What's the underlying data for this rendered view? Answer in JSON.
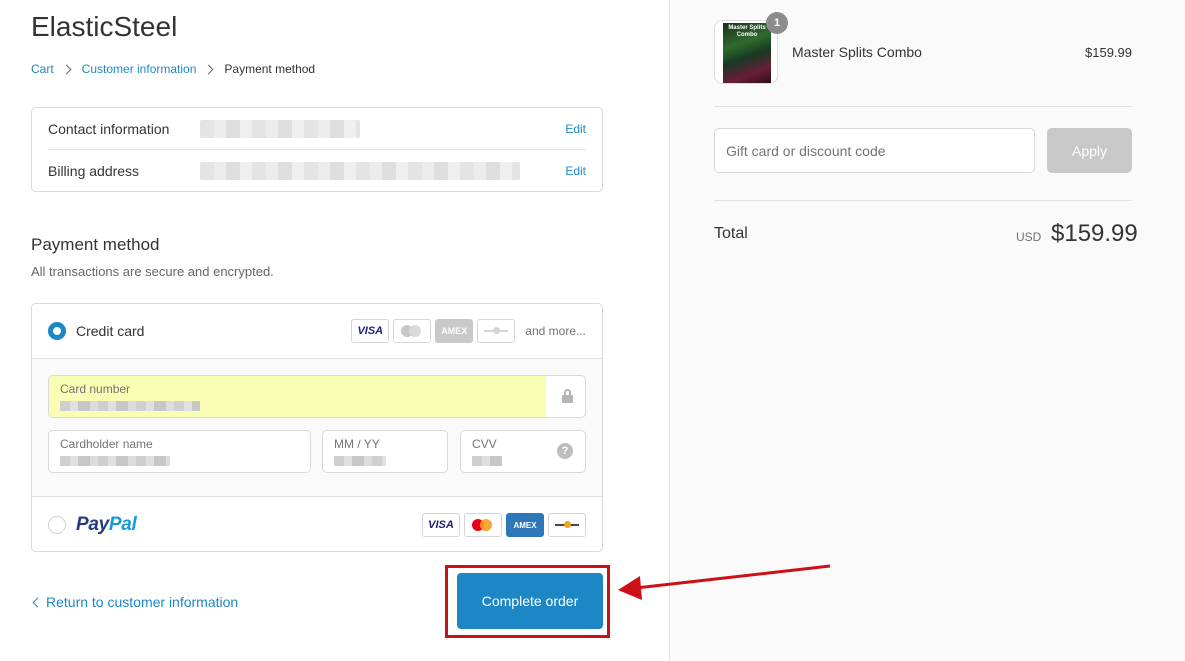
{
  "shop": {
    "title": "ElasticSteel"
  },
  "breadcrumb": {
    "cart": "Cart",
    "customer_info": "Customer information",
    "current": "Payment method"
  },
  "review": {
    "contact_label": "Contact information",
    "billing_label": "Billing address",
    "edit_label": "Edit"
  },
  "payment": {
    "title": "Payment method",
    "subtitle": "All transactions are secure and encrypted.",
    "credit_card_label": "Credit card",
    "and_more": "and more...",
    "card_visa": "VISA",
    "card_amex": "AMEX",
    "fields": {
      "card_number_label": "Card number",
      "cardholder_label": "Cardholder name",
      "expiry_label": "MM / YY",
      "cvv_label": "CVV",
      "help_glyph": "?"
    },
    "paypal": {
      "pay": "Pay",
      "pal": "Pal"
    }
  },
  "actions": {
    "return_label": "Return to customer information",
    "complete_label": "Complete order"
  },
  "summary": {
    "product_name": "Master Splits Combo",
    "product_price": "$159.99",
    "quantity": "1",
    "thumb_text": "Master Splits Combo",
    "discount_placeholder": "Gift card or discount code",
    "apply_label": "Apply",
    "total_label": "Total",
    "currency": "USD",
    "total_amount": "$159.99"
  },
  "colors": {
    "accent": "#1d87c6",
    "highlight": "#cc1016",
    "autofill": "#fafdb4"
  },
  "icons": [
    "chevron-right-icon",
    "lock-icon",
    "help-icon",
    "chevron-left-icon",
    "visa-icon",
    "mastercard-icon",
    "amex-icon",
    "discover-icon",
    "paypal-logo",
    "red-arrow-icon"
  ]
}
